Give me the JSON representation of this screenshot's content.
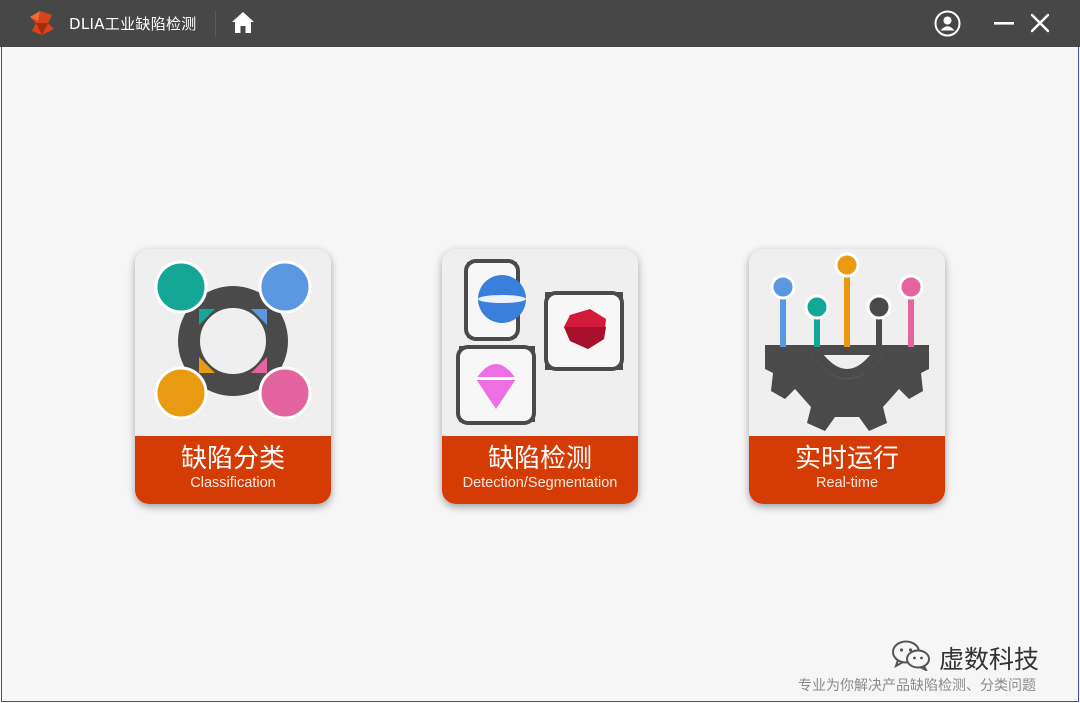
{
  "window": {
    "title": "DLIA工业缺陷检测"
  },
  "cards": [
    {
      "title": "缺陷分类",
      "subtitle": "Classification"
    },
    {
      "title": "缺陷检测",
      "subtitle": "Detection/Segmentation"
    },
    {
      "title": "实时运行",
      "subtitle": "Real-time"
    }
  ],
  "watermark": {
    "name": "虚数科技",
    "slogan": "专业为你解决产品缺陷检测、分类问题"
  },
  "icons": {
    "logo": "app-logo",
    "home": "home-icon",
    "user": "user-icon",
    "minimize": "minimize-icon",
    "close": "close-icon"
  },
  "colors": {
    "titlebar": "#474747",
    "accent": "#d43b05",
    "teal": "#14a697",
    "blue": "#5b97e0",
    "orange": "#e89a10",
    "pink": "#e3649f"
  }
}
